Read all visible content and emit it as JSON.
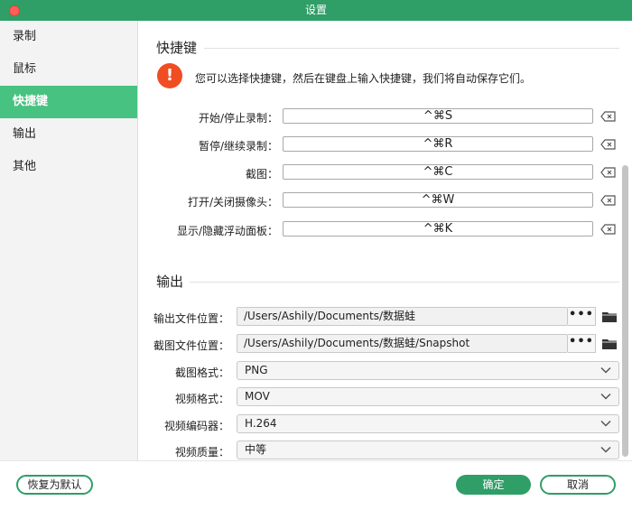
{
  "window": {
    "title": "设置"
  },
  "sidebar": {
    "items": [
      {
        "label": "录制"
      },
      {
        "label": "鼠标"
      },
      {
        "label": "快捷键"
      },
      {
        "label": "输出"
      },
      {
        "label": "其他"
      }
    ],
    "active_index": 2
  },
  "shortcuts": {
    "heading": "快捷键",
    "info": "您可以选择快捷键，然后在键盘上输入快捷键，我们将自动保存它们。",
    "rows": [
      {
        "label": "开始/停止录制：",
        "value": "^⌘S"
      },
      {
        "label": "暂停/继续录制：",
        "value": "^⌘R"
      },
      {
        "label": "截图：",
        "value": "^⌘C"
      },
      {
        "label": "打开/关闭摄像头：",
        "value": "^⌘W"
      },
      {
        "label": "显示/隐藏浮动面板：",
        "value": "^⌘K"
      }
    ]
  },
  "output": {
    "heading": "输出",
    "output_path": {
      "label": "输出文件位置：",
      "value": "/Users/Ashily/Documents/数据蛙",
      "more": "•••"
    },
    "snapshot_path": {
      "label": "截图文件位置：",
      "value": "/Users/Ashily/Documents/数据蛙/Snapshot",
      "more": "•••"
    },
    "screenshot_format": {
      "label": "截图格式：",
      "value": "PNG"
    },
    "video_format": {
      "label": "视频格式：",
      "value": "MOV"
    },
    "video_codec": {
      "label": "视频编码器：",
      "value": "H.264"
    },
    "video_quality": {
      "label": "视频质量：",
      "value": "中等"
    }
  },
  "footer": {
    "reset_label": "恢复为默认",
    "ok_label": "确定",
    "cancel_label": "取消"
  },
  "colors": {
    "titlebar": "#2f9e67",
    "sidebar_active": "#47c281",
    "warning": "#f04d23",
    "primary_button": "#2f9e67"
  }
}
